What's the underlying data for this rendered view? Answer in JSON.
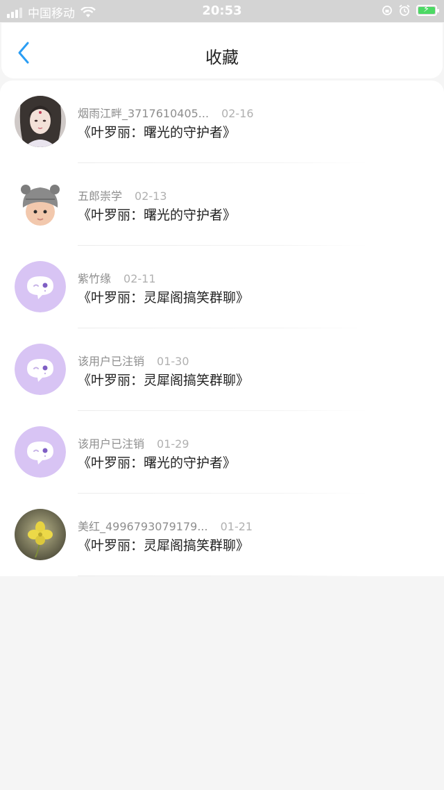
{
  "status_bar": {
    "carrier": "中国移动",
    "time": "20:53",
    "battery_color": "#4cd964"
  },
  "nav": {
    "back_icon": "chevron-left-icon",
    "title": "收藏",
    "accent": "#2a9df4"
  },
  "items": [
    {
      "user": "烟雨江畔_3717610405...",
      "date": "02-16",
      "title": "《叶罗丽：曙光的守护者》",
      "avatar": "girl-portrait"
    },
    {
      "user": "五郎崇学",
      "date": "02-13",
      "title": "《叶罗丽：曙光的守护者》",
      "avatar": "baby-photo"
    },
    {
      "user": "紫竹缘",
      "date": "02-11",
      "title": "《叶罗丽：灵犀阁搞笑群聊》",
      "avatar": "default-chat-bubble"
    },
    {
      "user": "该用户已注销",
      "date": "01-30",
      "title": "《叶罗丽：灵犀阁搞笑群聊》",
      "avatar": "default-chat-bubble"
    },
    {
      "user": "该用户已注销",
      "date": "01-29",
      "title": "《叶罗丽：曙光的守护者》",
      "avatar": "default-chat-bubble"
    },
    {
      "user": "美红_4996793079179...",
      "date": "01-21",
      "title": "《叶罗丽：灵犀阁搞笑群聊》",
      "avatar": "clover-photo"
    }
  ]
}
